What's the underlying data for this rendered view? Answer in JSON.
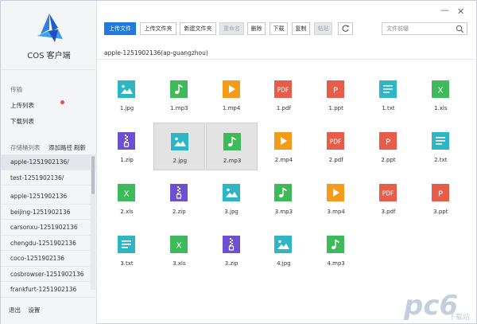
{
  "app": {
    "name": "COS 客户端"
  },
  "sidebar": {
    "transfer_section": "传输",
    "upload_list": "上传列表",
    "download_list": "下载列表",
    "bucket_section": "存储桶列表",
    "add_path": "添加路径",
    "refresh": "刷新",
    "buckets": [
      "apple-1251902136/",
      "test-1251902136/",
      "apple-1251902136",
      "beijing-1251902136",
      "carsonxu-1251902136",
      "chengdu-1251902136",
      "coco-1251902136",
      "cosbrowser-1251902136",
      "frankfurt-1251902136"
    ],
    "exit": "退出",
    "settings": "设置"
  },
  "toolbar": {
    "upload_file": "上传文件",
    "upload_folder": "上传文件夹",
    "new_folder": "新建文件夹",
    "rename": "重命名",
    "delete": "删除",
    "download": "下载",
    "copy": "复制",
    "paste": "粘贴"
  },
  "search": {
    "placeholder": "文件前缀"
  },
  "breadcrumb": "apple-1251902136(ap-guangzhou)",
  "files": [
    {
      "name": "1.jpg",
      "kind": "image"
    },
    {
      "name": "1.mp3",
      "kind": "audio"
    },
    {
      "name": "1.mp4",
      "kind": "video"
    },
    {
      "name": "1.pdf",
      "kind": "pdf"
    },
    {
      "name": "1.ppt",
      "kind": "ppt"
    },
    {
      "name": "1.txt",
      "kind": "txt"
    },
    {
      "name": "1.xls",
      "kind": "xls"
    },
    {
      "name": "1.zip",
      "kind": "zip"
    },
    {
      "name": "2.jpg",
      "kind": "image",
      "selected": true
    },
    {
      "name": "2.mp3",
      "kind": "audio",
      "selected": true
    },
    {
      "name": "2.mp4",
      "kind": "video"
    },
    {
      "name": "2.pdf",
      "kind": "pdf"
    },
    {
      "name": "2.ppt",
      "kind": "ppt"
    },
    {
      "name": "2.txt",
      "kind": "txt"
    },
    {
      "name": "2.xls",
      "kind": "xls"
    },
    {
      "name": "2.zip",
      "kind": "zip"
    },
    {
      "name": "3.jpg",
      "kind": "image"
    },
    {
      "name": "3.mp3",
      "kind": "audio"
    },
    {
      "name": "3.mp4",
      "kind": "video"
    },
    {
      "name": "3.pdf",
      "kind": "pdf"
    },
    {
      "name": "3.ppt",
      "kind": "ppt"
    },
    {
      "name": "3.txt",
      "kind": "txt"
    },
    {
      "name": "3.xls",
      "kind": "xls"
    },
    {
      "name": "3.zip",
      "kind": "zip"
    },
    {
      "name": "4.jpg",
      "kind": "image"
    },
    {
      "name": "4.mp3",
      "kind": "audio"
    }
  ],
  "icon_glyphs": {
    "pdf": "PDF",
    "ppt": "P",
    "xls": "X"
  },
  "colors": {
    "image": "#2eb6c5",
    "audio": "#3fba5a",
    "video": "#f59b1c",
    "pdf": "#e85c4a",
    "ppt": "#e85c4a",
    "txt": "#2eb6c5",
    "xls": "#3fba5a",
    "zip": "#6d4fd2",
    "accent": "#1e7ae0",
    "notification": "#e8504c"
  },
  "watermark": {
    "brand": "pc6",
    "tagline": "下载站"
  }
}
